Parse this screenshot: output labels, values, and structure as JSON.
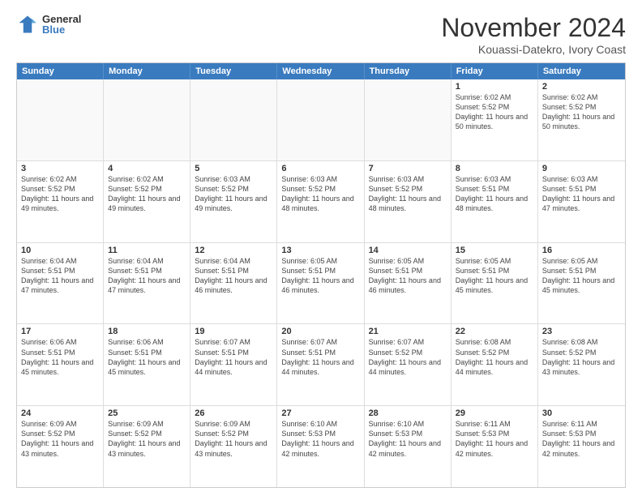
{
  "logo": {
    "general": "General",
    "blue": "Blue"
  },
  "header": {
    "month": "November 2024",
    "location": "Kouassi-Datekro, Ivory Coast"
  },
  "weekdays": [
    "Sunday",
    "Monday",
    "Tuesday",
    "Wednesday",
    "Thursday",
    "Friday",
    "Saturday"
  ],
  "rows": [
    [
      {
        "day": "",
        "info": "",
        "empty": true
      },
      {
        "day": "",
        "info": "",
        "empty": true
      },
      {
        "day": "",
        "info": "",
        "empty": true
      },
      {
        "day": "",
        "info": "",
        "empty": true
      },
      {
        "day": "",
        "info": "",
        "empty": true
      },
      {
        "day": "1",
        "info": "Sunrise: 6:02 AM\nSunset: 5:52 PM\nDaylight: 11 hours and 50 minutes.",
        "empty": false
      },
      {
        "day": "2",
        "info": "Sunrise: 6:02 AM\nSunset: 5:52 PM\nDaylight: 11 hours and 50 minutes.",
        "empty": false
      }
    ],
    [
      {
        "day": "3",
        "info": "Sunrise: 6:02 AM\nSunset: 5:52 PM\nDaylight: 11 hours and 49 minutes.",
        "empty": false
      },
      {
        "day": "4",
        "info": "Sunrise: 6:02 AM\nSunset: 5:52 PM\nDaylight: 11 hours and 49 minutes.",
        "empty": false
      },
      {
        "day": "5",
        "info": "Sunrise: 6:03 AM\nSunset: 5:52 PM\nDaylight: 11 hours and 49 minutes.",
        "empty": false
      },
      {
        "day": "6",
        "info": "Sunrise: 6:03 AM\nSunset: 5:52 PM\nDaylight: 11 hours and 48 minutes.",
        "empty": false
      },
      {
        "day": "7",
        "info": "Sunrise: 6:03 AM\nSunset: 5:52 PM\nDaylight: 11 hours and 48 minutes.",
        "empty": false
      },
      {
        "day": "8",
        "info": "Sunrise: 6:03 AM\nSunset: 5:51 PM\nDaylight: 11 hours and 48 minutes.",
        "empty": false
      },
      {
        "day": "9",
        "info": "Sunrise: 6:03 AM\nSunset: 5:51 PM\nDaylight: 11 hours and 47 minutes.",
        "empty": false
      }
    ],
    [
      {
        "day": "10",
        "info": "Sunrise: 6:04 AM\nSunset: 5:51 PM\nDaylight: 11 hours and 47 minutes.",
        "empty": false
      },
      {
        "day": "11",
        "info": "Sunrise: 6:04 AM\nSunset: 5:51 PM\nDaylight: 11 hours and 47 minutes.",
        "empty": false
      },
      {
        "day": "12",
        "info": "Sunrise: 6:04 AM\nSunset: 5:51 PM\nDaylight: 11 hours and 46 minutes.",
        "empty": false
      },
      {
        "day": "13",
        "info": "Sunrise: 6:05 AM\nSunset: 5:51 PM\nDaylight: 11 hours and 46 minutes.",
        "empty": false
      },
      {
        "day": "14",
        "info": "Sunrise: 6:05 AM\nSunset: 5:51 PM\nDaylight: 11 hours and 46 minutes.",
        "empty": false
      },
      {
        "day": "15",
        "info": "Sunrise: 6:05 AM\nSunset: 5:51 PM\nDaylight: 11 hours and 45 minutes.",
        "empty": false
      },
      {
        "day": "16",
        "info": "Sunrise: 6:05 AM\nSunset: 5:51 PM\nDaylight: 11 hours and 45 minutes.",
        "empty": false
      }
    ],
    [
      {
        "day": "17",
        "info": "Sunrise: 6:06 AM\nSunset: 5:51 PM\nDaylight: 11 hours and 45 minutes.",
        "empty": false
      },
      {
        "day": "18",
        "info": "Sunrise: 6:06 AM\nSunset: 5:51 PM\nDaylight: 11 hours and 45 minutes.",
        "empty": false
      },
      {
        "day": "19",
        "info": "Sunrise: 6:07 AM\nSunset: 5:51 PM\nDaylight: 11 hours and 44 minutes.",
        "empty": false
      },
      {
        "day": "20",
        "info": "Sunrise: 6:07 AM\nSunset: 5:51 PM\nDaylight: 11 hours and 44 minutes.",
        "empty": false
      },
      {
        "day": "21",
        "info": "Sunrise: 6:07 AM\nSunset: 5:52 PM\nDaylight: 11 hours and 44 minutes.",
        "empty": false
      },
      {
        "day": "22",
        "info": "Sunrise: 6:08 AM\nSunset: 5:52 PM\nDaylight: 11 hours and 44 minutes.",
        "empty": false
      },
      {
        "day": "23",
        "info": "Sunrise: 6:08 AM\nSunset: 5:52 PM\nDaylight: 11 hours and 43 minutes.",
        "empty": false
      }
    ],
    [
      {
        "day": "24",
        "info": "Sunrise: 6:09 AM\nSunset: 5:52 PM\nDaylight: 11 hours and 43 minutes.",
        "empty": false
      },
      {
        "day": "25",
        "info": "Sunrise: 6:09 AM\nSunset: 5:52 PM\nDaylight: 11 hours and 43 minutes.",
        "empty": false
      },
      {
        "day": "26",
        "info": "Sunrise: 6:09 AM\nSunset: 5:52 PM\nDaylight: 11 hours and 43 minutes.",
        "empty": false
      },
      {
        "day": "27",
        "info": "Sunrise: 6:10 AM\nSunset: 5:53 PM\nDaylight: 11 hours and 42 minutes.",
        "empty": false
      },
      {
        "day": "28",
        "info": "Sunrise: 6:10 AM\nSunset: 5:53 PM\nDaylight: 11 hours and 42 minutes.",
        "empty": false
      },
      {
        "day": "29",
        "info": "Sunrise: 6:11 AM\nSunset: 5:53 PM\nDaylight: 11 hours and 42 minutes.",
        "empty": false
      },
      {
        "day": "30",
        "info": "Sunrise: 6:11 AM\nSunset: 5:53 PM\nDaylight: 11 hours and 42 minutes.",
        "empty": false
      }
    ]
  ]
}
